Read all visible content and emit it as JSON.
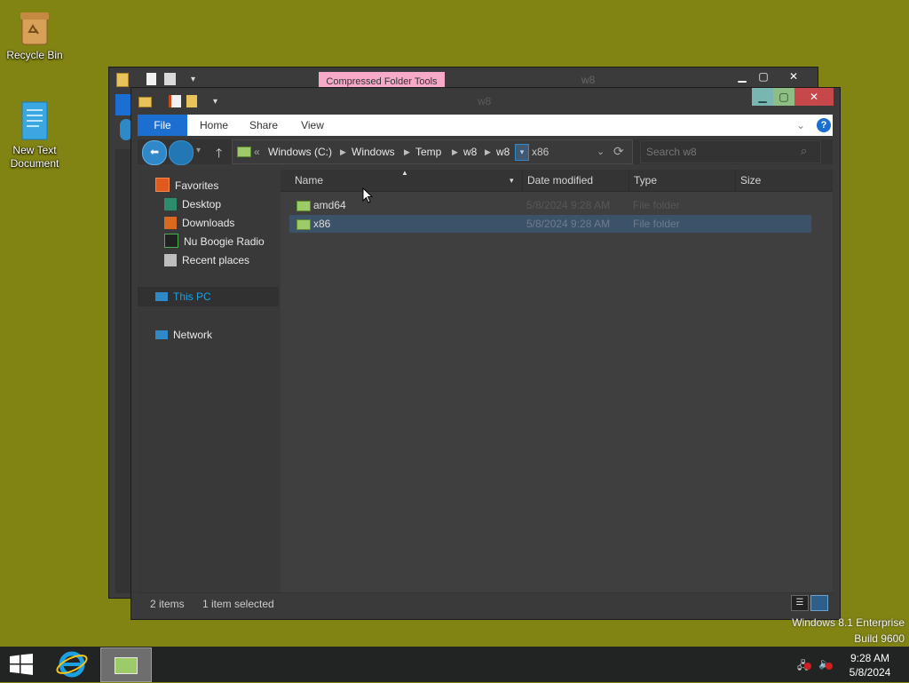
{
  "desktop": {
    "icons": [
      {
        "label": "Recycle Bin",
        "icon": "recycle-bin-icon"
      },
      {
        "label": "New Text Document",
        "icon": "text-document-icon"
      }
    ],
    "watermark": {
      "line1": "Windows 8.1 Enterprise",
      "line2": "Build 9600"
    }
  },
  "back_window": {
    "title": "w8",
    "context_tab": "Compressed Folder Tools",
    "context_tab_color": "#f6a9c9"
  },
  "front_window": {
    "title": "w8",
    "ribbon": {
      "tabs": [
        "File",
        "Home",
        "Share",
        "View"
      ],
      "file_tab_color": "#1b6fd1"
    },
    "address": {
      "overflow": "«",
      "crumbs": [
        "Windows (C:)",
        "Windows",
        "Temp",
        "w8",
        "w8",
        "x86"
      ]
    },
    "search": {
      "placeholder": "Search w8"
    },
    "nav": {
      "favorites": {
        "label": "Favorites",
        "items": [
          "Desktop",
          "Downloads",
          "Nu Boogie Radio",
          "Recent places"
        ]
      },
      "this_pc": "This PC",
      "network": "Network"
    },
    "columns": [
      "Name",
      "Date modified",
      "Type",
      "Size"
    ],
    "files": [
      {
        "name": "amd64",
        "modified": "5/8/2024 9:28 AM",
        "type": "File folder",
        "size": "",
        "selected": false
      },
      {
        "name": "x86",
        "modified": "5/8/2024 9:28 AM",
        "type": "File folder",
        "size": "",
        "selected": true
      }
    ],
    "status": {
      "count": "2 items",
      "selection": "1 item selected"
    }
  },
  "taskbar": {
    "clock_time": "9:28 AM",
    "clock_date": "5/8/2024",
    "accent": "#1ba1e2"
  }
}
